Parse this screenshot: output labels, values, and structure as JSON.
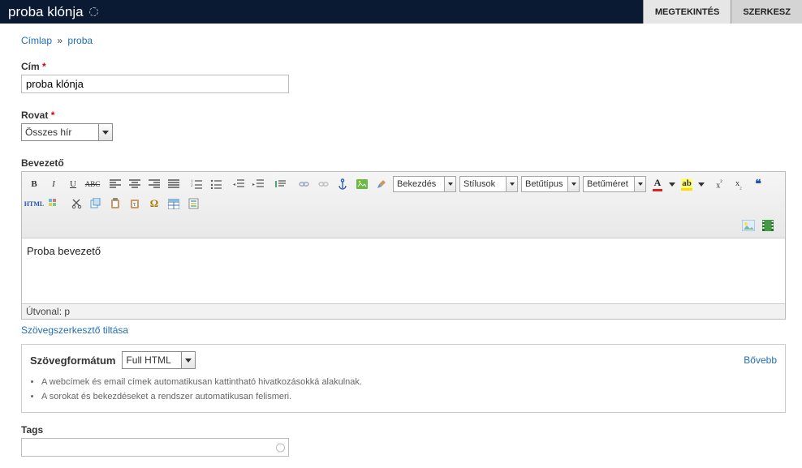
{
  "header": {
    "title": "proba klónja",
    "tabs": [
      {
        "label": "MEGTEKINTÉS",
        "active": true
      },
      {
        "label": "SZERKESZ"
      }
    ]
  },
  "breadcrumb": {
    "home": "Címlap",
    "item": "proba"
  },
  "fields": {
    "title": {
      "label": "Cím",
      "value": "proba klónja"
    },
    "rovat": {
      "label": "Rovat",
      "selected": "Összes hír"
    },
    "intro": {
      "label": "Bevezető",
      "body": "Proba bevezető",
      "path": "Útvonal: p"
    },
    "tags": {
      "label": "Tags",
      "value": ""
    }
  },
  "toolbar": {
    "format_select": "Bekezdés",
    "styles_select": "Stílusok",
    "font_select": "Betűtípus",
    "size_select": "Betűméret"
  },
  "disable_editor_link": "Szövegszerkesztő tiltása",
  "format_box": {
    "label": "Szövegformátum",
    "selected": "Full HTML",
    "more": "Bővebb",
    "hints": [
      "A webcímek és email címek automatikusan kattintható hivatkozásokká alakulnak.",
      "A sorokat és bekezdéseket a rendszer automatikusan felismeri."
    ]
  }
}
